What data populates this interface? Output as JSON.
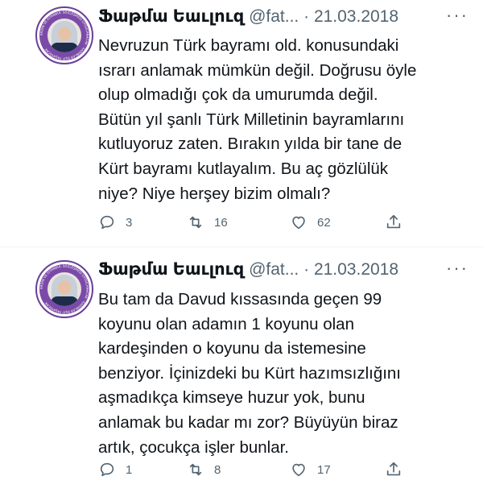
{
  "tweets": [
    {
      "name": "Ֆաթմա Եաւլուզ",
      "handle": "@fat...",
      "dot": "·",
      "date": "21.03.2018",
      "lines": [
        "Nevruzun Türk bayramı old. konusundaki",
        "ısrarı anlamak mümkün değil. Doğrusu öyle",
        "olup olmadığı çok da umurumda değil.",
        "Bütün yıl şanlı Türk Milletinin bayramlarını",
        "kutluyoruz zaten. Bırakın  yılda bir tane de",
        "Kürt bayramı kutlayalım. Bu aç gözlülük",
        "niye? Niye herşey bizim olmalı?"
      ],
      "replies": "3",
      "retweets": "16",
      "likes": "62"
    },
    {
      "name": "Ֆաթմա Եաւլուզ",
      "handle": "@fat...",
      "dot": "·",
      "date": "21.03.2018",
      "lines": [
        "Bu tam da Davud kıssasında geçen 99",
        "koyunu olan adamın 1 koyunu olan",
        "kardeşinden o koyunu da istemesine",
        "benziyor. İçinizdeki bu Kürt hazımsızlığını",
        "aşmadıkça kimseye huzur yok, bunu",
        "anlamak bu kadar mı zor? Büyüyün biraz",
        "artık, çocukça işler bunlar."
      ],
      "replies": "1",
      "retweets": "8",
      "likes": "17"
    }
  ],
  "avatar_ring_text": "KADIN VE İSTANBUL SÖZLEŞMESİ UYGULANACAK · KADINLAR EŞİT YAŞAYACAK",
  "more_label": "···",
  "colors": {
    "text": "#0f1419",
    "secondary": "#536471",
    "ring": "#7b4aa8"
  }
}
